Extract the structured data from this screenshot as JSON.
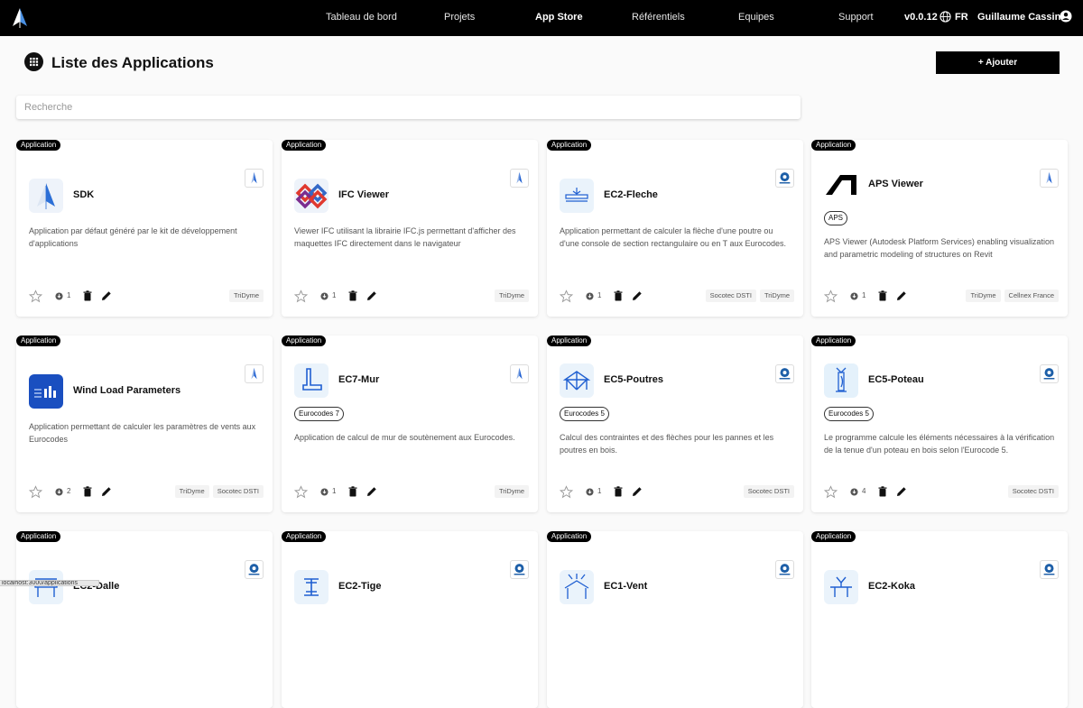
{
  "nav": {
    "items": [
      "Tableau de bord",
      "Projets",
      "App Store",
      "Référentiels",
      "Equipes",
      "Support"
    ],
    "active": "App Store",
    "version": "v0.0.12",
    "language": "FR",
    "user": "Guillaume Cassin"
  },
  "header": {
    "title": "Liste des Applications",
    "add_label": "+ Ajouter"
  },
  "search": {
    "placeholder": "Recherche",
    "value": ""
  },
  "badge_label": "Application",
  "cards": [
    {
      "title": "SDK",
      "icon": "sdk-logo-icon",
      "provider": "tridyme",
      "tag": "",
      "description": "Application par défaut généré par le kit de développement d'applications",
      "count": "1",
      "orgs": [
        "TriDyme"
      ]
    },
    {
      "title": "IFC Viewer",
      "icon": "ifc-logo-icon",
      "provider": "tridyme",
      "tag": "",
      "description": "Viewer IFC utilisant la librairie IFC.js permettant d'afficher des maquettes IFC directement dans le navigateur",
      "count": "1",
      "orgs": [
        "TriDyme"
      ]
    },
    {
      "title": "EC2-Fleche",
      "icon": "beam-icon",
      "provider": "socotec",
      "tag": "",
      "description": "Application permettant de calculer la flèche d'une poutre ou d'une console de section rectangulaire ou en T aux Eurocodes.",
      "count": "1",
      "orgs": [
        "Socotec DSTI",
        "TriDyme"
      ]
    },
    {
      "title": "APS Viewer",
      "icon": "autodesk-logo-icon",
      "provider": "tridyme",
      "tag": "APS",
      "description": "APS Viewer (Autodesk Platform Services) enabling visualization and parametric modeling of structures on Revit",
      "count": "1",
      "orgs": [
        "TriDyme",
        "Cellnex France"
      ]
    },
    {
      "title": "Wind Load Parameters",
      "icon": "wind-chart-icon",
      "provider": "tridyme",
      "tag": "",
      "description": "Application permettant de calculer les paramètres de vents aux Eurocodes",
      "count": "2",
      "orgs": [
        "TriDyme",
        "Socotec DSTI"
      ]
    },
    {
      "title": "EC7-Mur",
      "icon": "retaining-wall-icon",
      "provider": "tridyme",
      "tag": "Eurocodes 7",
      "description": "Application de calcul de mur de soutènement aux Eurocodes.",
      "count": "1",
      "orgs": [
        "TriDyme"
      ]
    },
    {
      "title": "EC5-Poutres",
      "icon": "roof-truss-icon",
      "provider": "socotec",
      "tag": "Eurocodes 5",
      "description": "Calcul des contraintes et des flèches pour les pannes et les poutres en bois.",
      "count": "1",
      "orgs": [
        "Socotec DSTI"
      ]
    },
    {
      "title": "EC5-Poteau",
      "icon": "column-icon",
      "provider": "socotec",
      "tag": "Eurocodes 5",
      "description": "Le programme calcule les éléments nécessaires à la vérification de la tenue d'un poteau en bois selon l'Eurocode 5.",
      "count": "4",
      "orgs": [
        "Socotec DSTI"
      ]
    },
    {
      "title": "EC2-Dalle",
      "icon": "slab-icon",
      "provider": "socotec",
      "tag": "",
      "description": "",
      "count": "",
      "orgs": []
    },
    {
      "title": "EC2-Tige",
      "icon": "rod-icon",
      "provider": "socotec",
      "tag": "",
      "description": "",
      "count": "",
      "orgs": []
    },
    {
      "title": "EC1-Vent",
      "icon": "wind-structure-icon",
      "provider": "socotec",
      "tag": "",
      "description": "",
      "count": "",
      "orgs": []
    },
    {
      "title": "EC2-Koka",
      "icon": "koka-icon",
      "provider": "socotec",
      "tag": "",
      "description": "",
      "count": "",
      "orgs": []
    }
  ],
  "statusbar": {
    "text": "localhost:3000/applications"
  },
  "colors": {
    "bar": "#000000",
    "accent": "#1f5fd1",
    "icon_bg": "#eaf3fb",
    "socotec": "#1d5fa8"
  }
}
